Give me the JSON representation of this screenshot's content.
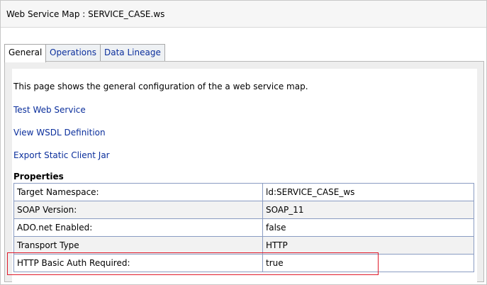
{
  "header": {
    "title": "Web Service Map : SERVICE_CASE.ws"
  },
  "tabs": [
    {
      "label": "General",
      "active": true
    },
    {
      "label": "Operations",
      "active": false
    },
    {
      "label": "Data Lineage",
      "active": false
    }
  ],
  "general": {
    "description": "This page shows the general configuration of the a web service map.",
    "links": {
      "test": "Test Web Service",
      "wsdl": "View WSDL Definition",
      "export": "Export Static Client Jar"
    },
    "properties_heading": "Properties",
    "properties": [
      {
        "key": "Target Namespace:",
        "value": "ld:SERVICE_CASE_ws"
      },
      {
        "key": "SOAP Version:",
        "value": "SOAP_11"
      },
      {
        "key": "ADO.net Enabled:",
        "value": "false"
      },
      {
        "key": "Transport Type",
        "value": "HTTP"
      },
      {
        "key": "HTTP Basic Auth Required:",
        "value": "true"
      }
    ]
  },
  "colors": {
    "link": "#0b2f9c",
    "highlight": "#e01b2b",
    "table_border": "#8a9cc2"
  }
}
